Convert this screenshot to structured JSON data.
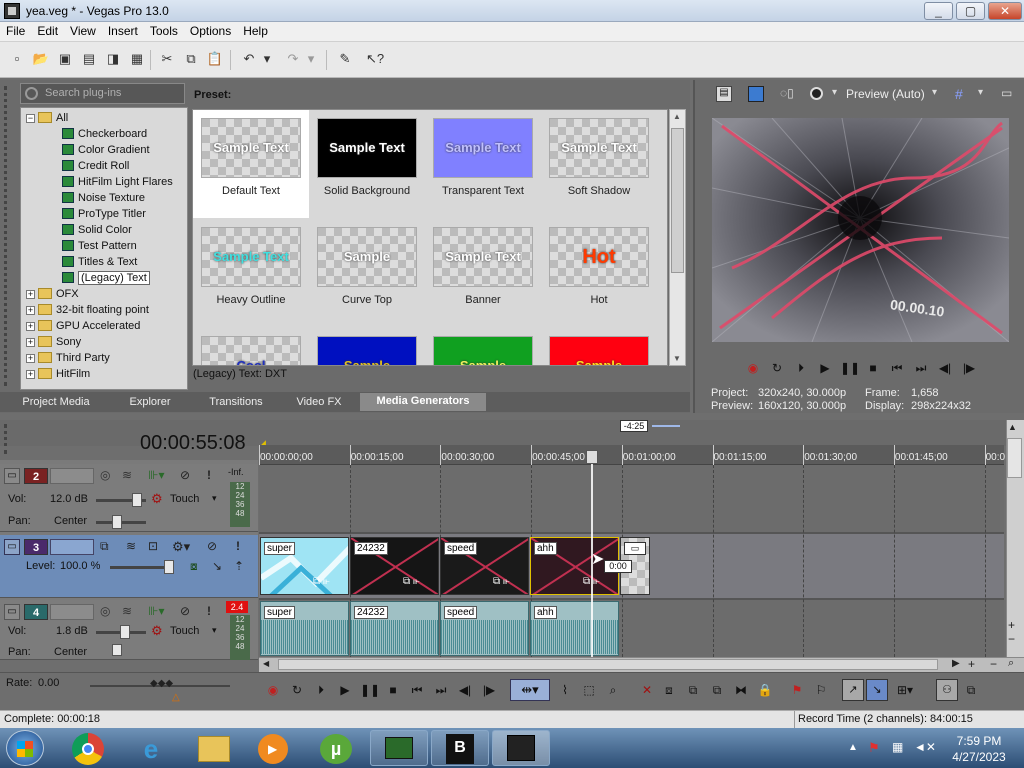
{
  "window": {
    "title": "yea.veg * - Vegas Pro 13.0",
    "min": "_",
    "max": "▢",
    "close": "✕"
  },
  "menu": [
    "File",
    "Edit",
    "View",
    "Insert",
    "Tools",
    "Options",
    "Help"
  ],
  "plugins": {
    "search_placeholder": "Search plug-ins",
    "tree": [
      {
        "label": "All",
        "type": "folder",
        "expanded": true
      },
      {
        "label": "Checkerboard",
        "type": "gen"
      },
      {
        "label": "Color Gradient",
        "type": "gen"
      },
      {
        "label": "Credit Roll",
        "type": "gen"
      },
      {
        "label": "HitFilm Light Flares",
        "type": "gen"
      },
      {
        "label": "Noise Texture",
        "type": "gen"
      },
      {
        "label": "ProType Titler",
        "type": "gen"
      },
      {
        "label": "Solid Color",
        "type": "gen"
      },
      {
        "label": "Test Pattern",
        "type": "gen"
      },
      {
        "label": "Titles & Text",
        "type": "gen"
      },
      {
        "label": "(Legacy) Text",
        "type": "gen",
        "selected": true
      },
      {
        "label": "OFX",
        "type": "folder"
      },
      {
        "label": "32-bit floating point",
        "type": "folder"
      },
      {
        "label": "GPU Accelerated",
        "type": "folder"
      },
      {
        "label": "Sony",
        "type": "folder"
      },
      {
        "label": "Third Party",
        "type": "folder"
      },
      {
        "label": "HitFilm",
        "type": "folder"
      }
    ],
    "preset_title": "Preset:",
    "presets": [
      {
        "name": "Default Text",
        "thumb": "Sample Text",
        "bg": "checker",
        "color": "#ffffff",
        "selected": true
      },
      {
        "name": "Solid Background",
        "thumb": "Sample Text",
        "bg": "#000000",
        "color": "#ffffff"
      },
      {
        "name": "Transparent Text",
        "thumb": "Sample Text",
        "bg": "#8080ff",
        "color": "#c0c0ff"
      },
      {
        "name": "Soft Shadow",
        "thumb": "Sample Text",
        "bg": "checker",
        "color": "#ffffff"
      },
      {
        "name": "Heavy Outline",
        "thumb": "Sample Text",
        "bg": "checker",
        "color": "#40e0e0"
      },
      {
        "name": "Curve Top",
        "thumb": "Sample",
        "bg": "checker",
        "color": "#ffffff"
      },
      {
        "name": "Banner",
        "thumb": "Sample Text",
        "bg": "checker",
        "color": "#ffffff"
      },
      {
        "name": "Hot",
        "thumb": "Hot",
        "bg": "checker",
        "color": "#ff3a00"
      },
      {
        "name": "",
        "thumb": "Cool",
        "bg": "checker",
        "color": "#2030c0"
      },
      {
        "name": "",
        "thumb": "Sample",
        "bg": "#0010c0",
        "color": "#e0c020"
      },
      {
        "name": "",
        "thumb": "Sample",
        "bg": "#10a020",
        "color": "#f0f060"
      },
      {
        "name": "",
        "thumb": "Sample",
        "bg": "#ff0010",
        "color": "#ffe020"
      }
    ],
    "status": "(Legacy) Text: DXT",
    "tabs": [
      "Project Media",
      "Explorer",
      "Transitions",
      "Video FX",
      "Media Generators"
    ],
    "active_tab": "Media Generators"
  },
  "preview": {
    "mode": "Preview (Auto)",
    "project_label": "Project:",
    "project_value": "320x240, 30.000p",
    "preview_label": "Preview:",
    "preview_value": "160x120, 30.000p",
    "frame_label": "Frame:",
    "frame_value": "1,658",
    "display_label": "Display:",
    "display_value": "298x224x32",
    "overlay_text": "00.00.10"
  },
  "timeline": {
    "timecode": "00:00:55:08",
    "marker": "-4:25",
    "ruler": [
      "00:00:00;00",
      "00:00:15;00",
      "00:00:30;00",
      "00:00:45;00",
      "00:01:00;00",
      "00:01:15;00",
      "00:01:30;00",
      "00:01:45;00",
      "00:0"
    ],
    "tracks": [
      {
        "num": "2",
        "kind": "audio",
        "vol_label": "Vol:",
        "vol": "12.0 dB",
        "pan_label": "Pan:",
        "pan": "Center",
        "mode": "Touch",
        "peak": "-Inf.",
        "meter": [
          "12",
          "24",
          "36",
          "48"
        ]
      },
      {
        "num": "3",
        "kind": "video",
        "level_label": "Level:",
        "level": "100.0 %"
      },
      {
        "num": "4",
        "kind": "audio",
        "vol_label": "Vol:",
        "vol": "1.8 dB",
        "pan_label": "Pan:",
        "pan": "Center",
        "mode": "Touch",
        "peak": "2.4",
        "meter": [
          "12",
          "24",
          "36",
          "48"
        ]
      }
    ],
    "video_clips": [
      {
        "label": "super",
        "color": "#7fd8f0"
      },
      {
        "label": "24232",
        "color": "#151515"
      },
      {
        "label": "speed",
        "color": "#1a1a1a"
      },
      {
        "label": "ahh",
        "color": "#301820"
      }
    ],
    "clip_tooltip": "0:00",
    "audio_clips": [
      "super",
      "24232",
      "speed",
      "ahh"
    ],
    "rate_label": "Rate:",
    "rate": "0.00"
  },
  "statusbar": {
    "left": "Complete: 00:00:18",
    "right": "Record Time (2 channels): 84:00:15"
  },
  "clock": {
    "time": "7:59 PM",
    "date": "4/27/2023"
  }
}
